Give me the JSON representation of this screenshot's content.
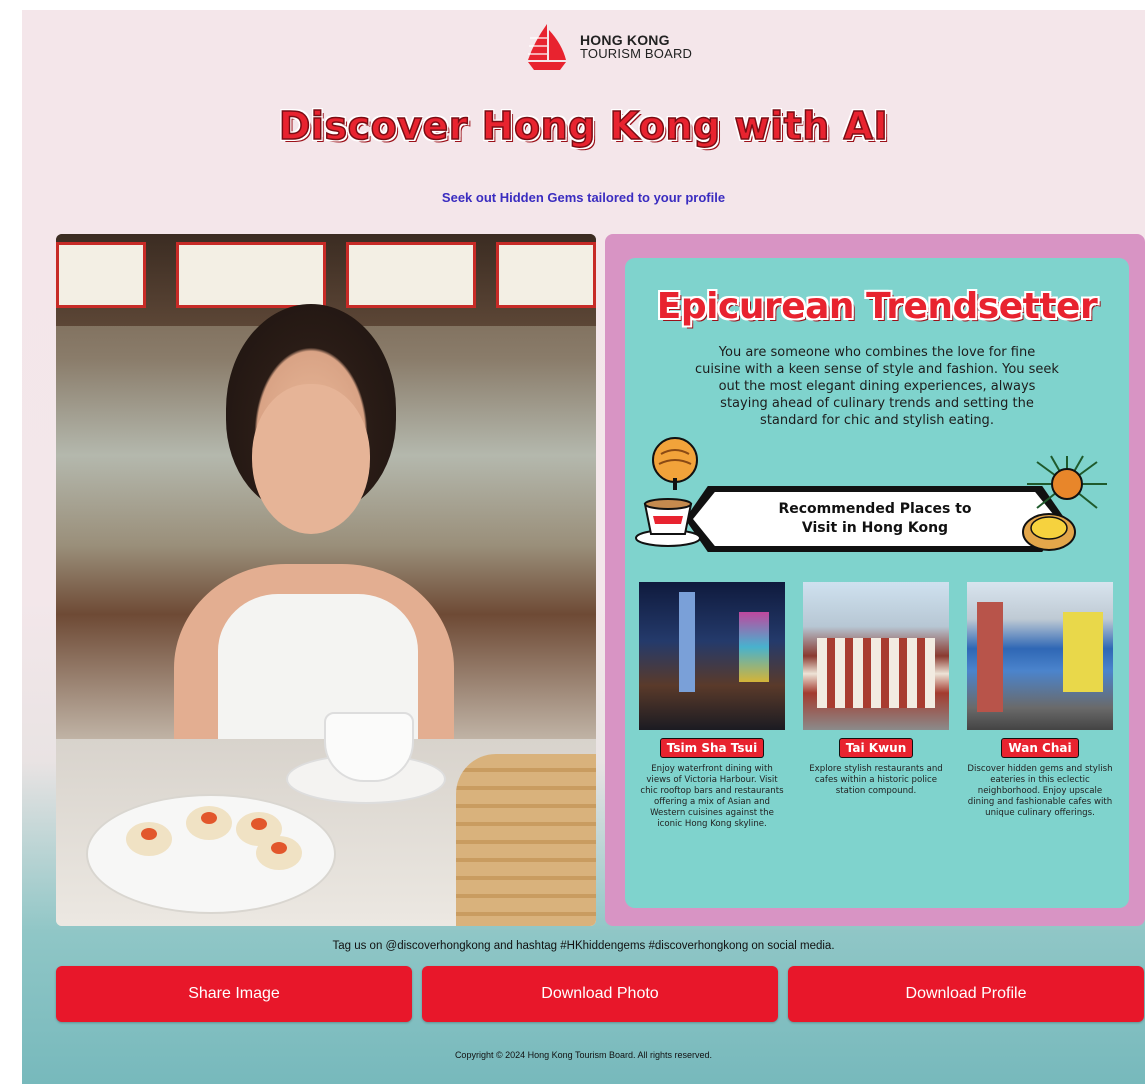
{
  "header": {
    "logo_line1": "HONG KONG",
    "logo_line2": "TOURISM BOARD",
    "title": "Discover Hong Kong with AI",
    "subtitle": "Seek out Hidden Gems tailored to your profile"
  },
  "profile": {
    "title": "Epicurean Trendsetter",
    "description": "You are someone who combines the love for fine cuisine with a keen sense of style and fashion. You seek out the most elegant dining experiences, always staying ahead of culinary trends and setting the standard for chic and stylish eating.",
    "banner_line1": "Recommended Places to",
    "banner_line2": "Visit in Hong Kong",
    "places": [
      {
        "name": "Tsim Sha Tsui",
        "text": "Enjoy waterfront dining with views of Victoria Harbour. Visit chic rooftop bars and restaurants offering a mix of Asian and Western cuisines against the iconic Hong Kong skyline."
      },
      {
        "name": "Tai Kwun",
        "text": "Explore stylish restaurants and cafes within a historic police station compound."
      },
      {
        "name": "Wan Chai",
        "text": "Discover hidden gems and stylish eateries in this eclectic neighborhood. Enjoy upscale dining and fashionable cafes with unique culinary offerings."
      }
    ]
  },
  "footer": {
    "tag_text": "Tag us on @discoverhongkong and hashtag #HKhiddengems #discoverhongkong on social media.",
    "share_label": "Share Image",
    "download_photo_label": "Download Photo",
    "download_profile_label": "Download Profile",
    "copyright": "Copyright © 2024 Hong Kong Tourism Board. All rights reserved."
  },
  "colors": {
    "brand_red": "#e8232f",
    "button_red": "#e8172a",
    "card_pink": "#d894c4",
    "card_teal": "#7fd3cd",
    "subtitle_blue": "#3a2cc0"
  },
  "icons": [
    "junk-boat-logo-icon",
    "pineapple-bun-icon",
    "milk-tea-cup-icon",
    "sea-urchin-icon",
    "egg-tart-icon"
  ]
}
